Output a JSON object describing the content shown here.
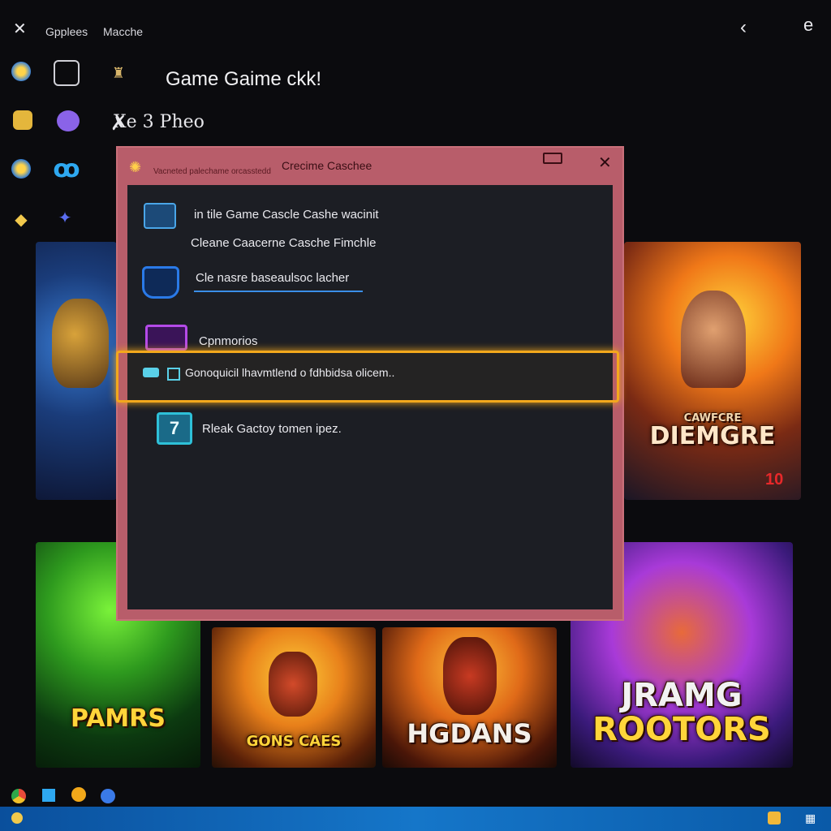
{
  "topbar": {
    "menu1": "Gpplees",
    "menu2": "Macche"
  },
  "header": {
    "title": "Game Gaime ckk!",
    "subtitle": "Xe 3 Pheo"
  },
  "dialog": {
    "title": "Crecime Caschee",
    "subtitle": "Vacneted palechame orcasstedd",
    "line1": "in tile Game Cascle Cashe wacinit",
    "line2": "Cleane Caacerne Casche Fimchle",
    "field_value": "Cle nasre baseaulsoc lacher",
    "option_label": "Cpnmorios",
    "highlight_text": "Gonoquicil lhavmtlend o fdhbidsa olicem..",
    "bottom_text": "Rleak Gactoy tomen ipez.",
    "bottom_icon_glyph": "7"
  },
  "tiles": {
    "right_top_label": "DIEMGRE",
    "right_top_sub": "CAWFCRE",
    "right_top_badge": "10",
    "green_label": "PAMRS",
    "mid1_label": "GONS CAES",
    "mid2_label": "HGDANS",
    "right_bottom_label1": "JRAMG",
    "right_bottom_label2": "ROOTORS"
  },
  "colors": {
    "dialog_frame": "#b85d6a",
    "dialog_body": "#1c1e24",
    "highlight": "#f3a81c",
    "taskbar": "#1576c9"
  }
}
